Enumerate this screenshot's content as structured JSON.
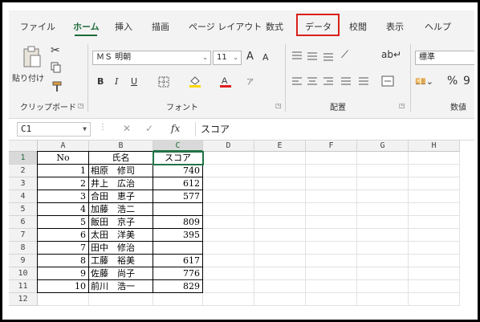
{
  "ribbon_tabs": [
    "ファイル",
    "ホーム",
    "挿入",
    "描画",
    "ページ レイアウト",
    "数式",
    "データ",
    "校閲",
    "表示",
    "ヘルプ"
  ],
  "active_tab": "ホーム",
  "highlighted_tab": "データ",
  "accent_color": "#217346",
  "highlight_color": "#d9201b",
  "clipboard": {
    "paste_label": "貼り付け",
    "group_label": "クリップボード"
  },
  "font": {
    "name": "ＭＳ 明朝",
    "size": "11",
    "group_label": "フォント",
    "bold": "B",
    "italic": "I",
    "underline": "U",
    "grow": "A",
    "shrink": "A"
  },
  "alignment": {
    "group_label": "配置"
  },
  "number": {
    "format": "標準",
    "group_label": "数値",
    "percent": "%"
  },
  "icons": [
    "paste-icon",
    "cut-icon",
    "copy-icon",
    "format-painter-icon",
    "borders-icon",
    "fill-color-icon",
    "font-color-icon",
    "wrap-text-icon",
    "merge-icon",
    "currency-icon"
  ],
  "formula_bar": {
    "name_box": "C1",
    "fx": "fx",
    "content": "スコア",
    "cancel": "✕",
    "enter": "✓"
  },
  "columns": [
    "A",
    "B",
    "C",
    "D",
    "E",
    "F",
    "G",
    "H"
  ],
  "selected_column": "C",
  "rows": [
    "1",
    "2",
    "3",
    "4",
    "5",
    "6",
    "7",
    "8",
    "9",
    "10",
    "11",
    "12"
  ],
  "selected_row": "1",
  "header_row": {
    "no": "No",
    "name": "氏名",
    "score": "スコア"
  },
  "records": [
    {
      "no": "1",
      "name": "相原　修司",
      "score": "740"
    },
    {
      "no": "2",
      "name": "井上　広治",
      "score": "612"
    },
    {
      "no": "3",
      "name": "合田　恵子",
      "score": "577"
    },
    {
      "no": "4",
      "name": "加藤　浩二",
      "score": ""
    },
    {
      "no": "5",
      "name": "飯田　京子",
      "score": "809"
    },
    {
      "no": "6",
      "name": "太田　洋美",
      "score": "395"
    },
    {
      "no": "7",
      "name": "田中　修治",
      "score": ""
    },
    {
      "no": "8",
      "name": "工藤　裕美",
      "score": "617"
    },
    {
      "no": "9",
      "name": "佐藤　尚子",
      "score": "776"
    },
    {
      "no": "10",
      "name": "前川　浩一",
      "score": "829"
    }
  ]
}
